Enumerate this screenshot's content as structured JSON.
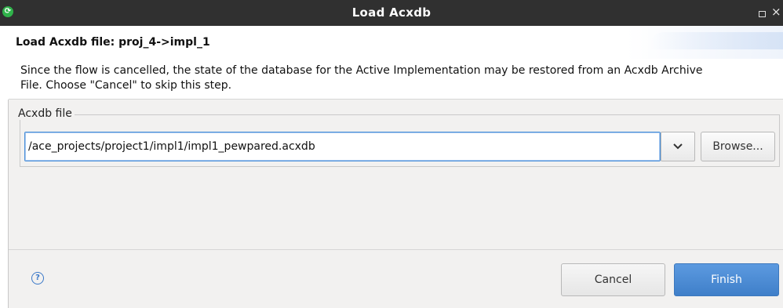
{
  "window": {
    "title": "Load Acxdb",
    "icon": "app-icon",
    "controls": [
      "maximize-icon",
      "close-icon"
    ],
    "close_glyph": "×"
  },
  "header": {
    "title": "Load Acxdb file: proj_4->impl_1",
    "description": "Since the flow is cancelled, the state of the database for the Active Implementation may be restored from an Acxdb Archive File. Choose \"Cancel\" to skip this step."
  },
  "acxdb_group": {
    "label": "Acxdb file",
    "file_value": "/ace_projects/project1/impl1/impl1_pewpared.acxdb",
    "dropdown_icon": "chevron-down-icon",
    "browse_label": "Browse..."
  },
  "footer": {
    "help_icon": "help-icon",
    "cancel_label": "Cancel",
    "finish_label": "Finish"
  },
  "colors": {
    "titlebar": "#303030",
    "accent": "#4a90d9",
    "finish_button": "#4a8ad4",
    "panel_bg": "#f2f1f0",
    "app_icon": "#2fb34a"
  }
}
